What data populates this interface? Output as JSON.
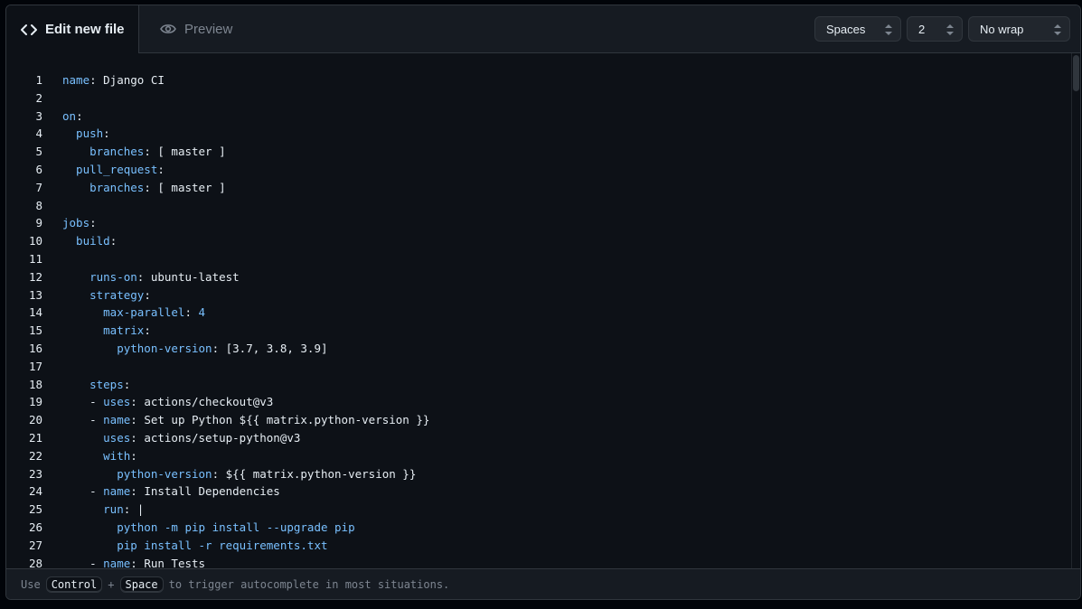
{
  "header": {
    "edit_tab_label": "Edit new file",
    "preview_tab_label": "Preview",
    "indent_mode": "Spaces",
    "indent_size": "2",
    "wrap_mode": "No wrap"
  },
  "editor": {
    "lines": [
      {
        "num": "1",
        "key": "name",
        "rest": ": Django CI"
      },
      {
        "num": "2",
        "key": "",
        "rest": ""
      },
      {
        "num": "3",
        "key": "on",
        "rest": ":"
      },
      {
        "num": "4",
        "key": "  push",
        "rest": ":"
      },
      {
        "num": "5",
        "key": "    branches",
        "rest": ": [ master ]"
      },
      {
        "num": "6",
        "key": "  pull_request",
        "rest": ":"
      },
      {
        "num": "7",
        "key": "    branches",
        "rest": ": [ master ]"
      },
      {
        "num": "8",
        "key": "",
        "rest": ""
      },
      {
        "num": "9",
        "key": "jobs",
        "rest": ":"
      },
      {
        "num": "10",
        "key": "  build",
        "rest": ":"
      },
      {
        "num": "11",
        "key": "",
        "rest": ""
      },
      {
        "num": "12",
        "key": "    runs-on",
        "rest": ": ubuntu-latest"
      },
      {
        "num": "13",
        "key": "    strategy",
        "rest": ":"
      },
      {
        "num": "14",
        "key": "      max-parallel",
        "rest": ": ",
        "num_val": "4"
      },
      {
        "num": "15",
        "key": "      matrix",
        "rest": ":"
      },
      {
        "num": "16",
        "key": "        python-version",
        "rest": ": [3.7, 3.8, 3.9]"
      },
      {
        "num": "17",
        "key": "",
        "rest": ""
      },
      {
        "num": "18",
        "key": "    steps",
        "rest": ":"
      },
      {
        "num": "19",
        "pre": "    - ",
        "key": "uses",
        "rest": ": actions/checkout@v3"
      },
      {
        "num": "20",
        "pre": "    - ",
        "key": "name",
        "rest": ": Set up Python ${{ matrix.python-version }}"
      },
      {
        "num": "21",
        "key": "      uses",
        "rest": ": actions/setup-python@v3"
      },
      {
        "num": "22",
        "key": "      with",
        "rest": ":"
      },
      {
        "num": "23",
        "key": "        python-version",
        "rest": ": ${{ matrix.python-version }}"
      },
      {
        "num": "24",
        "pre": "    - ",
        "key": "name",
        "rest": ": Install Dependencies"
      },
      {
        "num": "25",
        "key": "      run",
        "rest": ": |"
      },
      {
        "num": "26",
        "key": "",
        "rest": "        python -m pip install --upgrade pip",
        "rest_key": true
      },
      {
        "num": "27",
        "key": "",
        "rest": "        pip install -r requirements.txt",
        "rest_key": true
      },
      {
        "num": "28",
        "pre": "    - ",
        "key": "name",
        "rest": ": Run Tests"
      }
    ]
  },
  "footer": {
    "prefix": "Use",
    "key1": "Control",
    "plus": "+",
    "key2": "Space",
    "suffix": "to trigger autocomplete in most situations."
  },
  "icons": {
    "edit_tab": "code-icon",
    "preview_tab": "eye-icon",
    "select_arrows": "up-down-arrows-icon"
  },
  "colors": {
    "background": "#0d1117",
    "key": "#79c0ff",
    "text": "#e6edf3",
    "muted": "#7d8590",
    "border": "#30363d"
  }
}
